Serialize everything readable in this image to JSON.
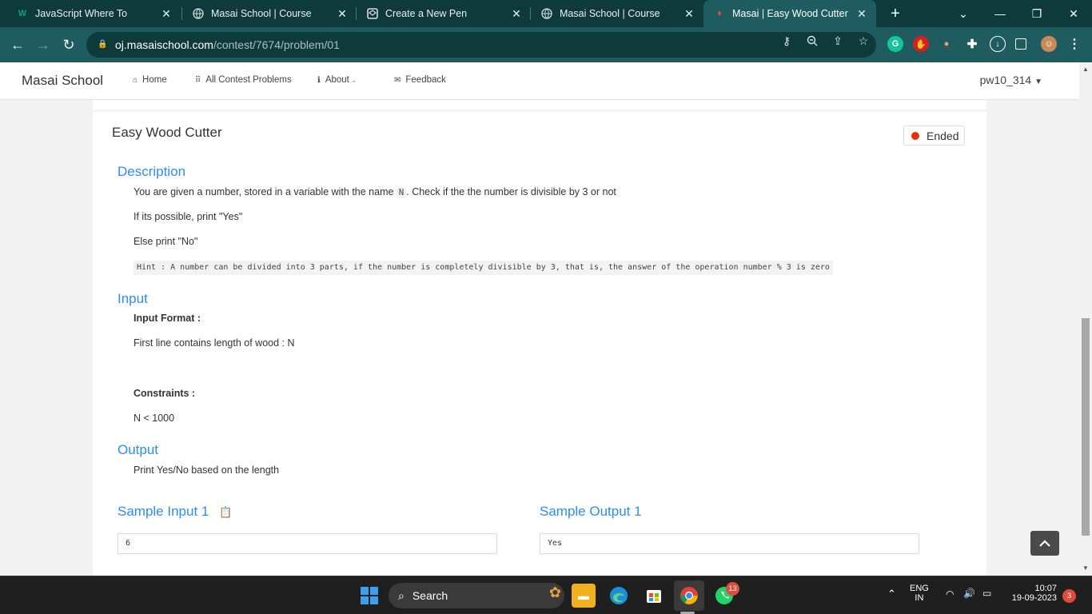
{
  "browser": {
    "tabs": [
      {
        "title": "JavaScript Where To",
        "favicon": "w3schools-icon"
      },
      {
        "title": "Masai School | Course",
        "favicon": "globe-icon"
      },
      {
        "title": "Create a New Pen",
        "favicon": "codepen-icon"
      },
      {
        "title": "Masai School | Course",
        "favicon": "globe-icon"
      },
      {
        "title": "Masai | Easy Wood Cutter",
        "favicon": "masai-icon",
        "active": true
      }
    ],
    "url_host": "oj.masaischool.com",
    "url_path": "/contest/7674/problem/01"
  },
  "site": {
    "brand": "Masai School",
    "nav": [
      "Home",
      "All Contest Problems",
      "About",
      "Feedback"
    ],
    "user": "pw10_314"
  },
  "problem": {
    "title": "Easy Wood Cutter",
    "status": "Ended",
    "description_heading": "Description",
    "desc_line1_pre": "You are given a number, stored in a variable with the name",
    "desc_var": "N",
    "desc_line1_post": ". Check if the the number is divisible by 3 or not",
    "desc_line2": "If its possible, print \"Yes\"",
    "desc_line3": "Else print \"No\"",
    "hint": "Hint : A number can be divided into 3 parts, if the number is completely divisible by 3, that is, the answer of the operation number % 3 is zero",
    "input_heading": "Input",
    "input_format_label": "Input Format :",
    "input_format": "First line contains length of wood : N",
    "constraints_label": "Constraints :",
    "constraints": "N < 1000",
    "output_heading": "Output",
    "output_text": "Print Yes/No based on the length",
    "sample_input_heading": "Sample Input 1",
    "sample_input": "6",
    "sample_output_heading": "Sample Output 1",
    "sample_output": "Yes"
  },
  "taskbar": {
    "search_label": "Search",
    "whatsapp_badge": "13",
    "lang": "ENG",
    "region": "IN",
    "time": "10:07",
    "date": "19-09-2023",
    "notif_count": "3"
  }
}
